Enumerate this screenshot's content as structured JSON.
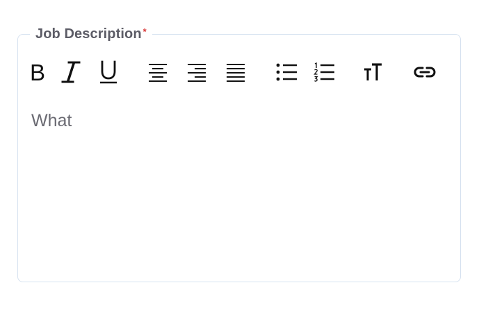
{
  "field": {
    "label": "Job Description",
    "required_marker": "*"
  },
  "toolbar": {
    "bold_label": "B",
    "italic_label": "I",
    "underline_label": "U",
    "tools": [
      "bold-icon",
      "italic-icon",
      "underline-icon",
      "align-center-icon",
      "align-right-icon",
      "align-justify-icon",
      "bulleted-list-icon",
      "numbered-list-icon",
      "text-size-icon",
      "link-icon"
    ]
  },
  "editor": {
    "content": "What"
  },
  "colors": {
    "border": "#d6e2f0",
    "label": "#5c5c66",
    "required": "#d93838",
    "icon": "#111111",
    "text": "#6a6a72"
  }
}
